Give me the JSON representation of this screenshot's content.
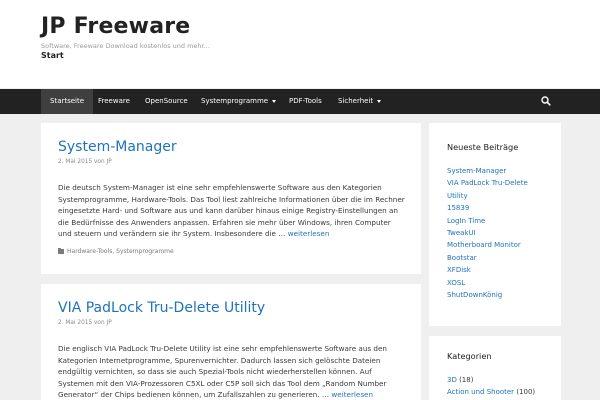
{
  "site": {
    "title": "JP Freeware",
    "tagline": "Software, Freeware Download kostenlos und mehr...",
    "start": "Start"
  },
  "nav": {
    "items": [
      {
        "label": "Startseite",
        "active": true
      },
      {
        "label": "Freeware"
      },
      {
        "label": "OpenSource"
      },
      {
        "label": "Systemprogramme",
        "dropdown": true
      },
      {
        "label": "PDF-Tools"
      },
      {
        "label": "Sicherheit",
        "dropdown": true
      }
    ],
    "search_icon": "search-icon"
  },
  "posts": [
    {
      "title": "System-Manager",
      "date": "2. Mai 2015",
      "by": "von",
      "author": "JP",
      "excerpt": "Die deutsch System-Manager ist eine sehr empfehlenswerte Software aus den Kategorien Systemprogramme, Hardware-Tools. Das Tool liest zahlreiche Informationen über die im Rechner eingesetzte Hard- und Software aus und kann darüber hinaus einige Registry-Einstellungen an die Bedürfnisse des Anwenders anpassen. Erfahren sie mehr über Windows, ihren Computer und steuern und verändern sie ihr System. Insbesondere die …",
      "more": "weiterlesen",
      "categories": "Hardware-Tools, Systemprogramme"
    },
    {
      "title": "VIA PadLock Tru-Delete Utility",
      "date": "2. Mai 2015",
      "by": "von",
      "author": "JP",
      "excerpt": "Die englisch VIA PadLock Tru-Delete Utility ist eine sehr empfehlenswerte Software aus den Kategorien Internetprogramme, Spurenvernichter. Dadurch lassen sich gelöschte Dateien endgültig vernichten, so dass sie auch Spezial-Tools nicht wiederherstellen können. Auf Systemen mit den VIA-Prozessoren C5XL oder C5P soll sich das Tool dem „Random Number Generator“ der Chips bedienen können, um Zufallszahlen zu generieren. …",
      "more": "weiterlesen"
    }
  ],
  "sidebar": {
    "recent": {
      "title": "Neueste Beiträge",
      "items": [
        "System-Manager",
        "VIA PadLock Tru-Delete Utility",
        "15839",
        "LogIn Time",
        "TweakUI",
        "Motherboard Monitor",
        "Bootstar",
        "XFDisk",
        "XOSL",
        "ShutDownKönig"
      ]
    },
    "categories": {
      "title": "Kategorien",
      "items": [
        {
          "label": "3D",
          "count": "(18)"
        },
        {
          "label": "Action und Shooter",
          "count": "(100)"
        }
      ]
    }
  },
  "colors": {
    "link": "#1e73be",
    "nav_bg": "#222222",
    "nav_active": "#3f3f3f",
    "page_bg": "#efefef"
  }
}
